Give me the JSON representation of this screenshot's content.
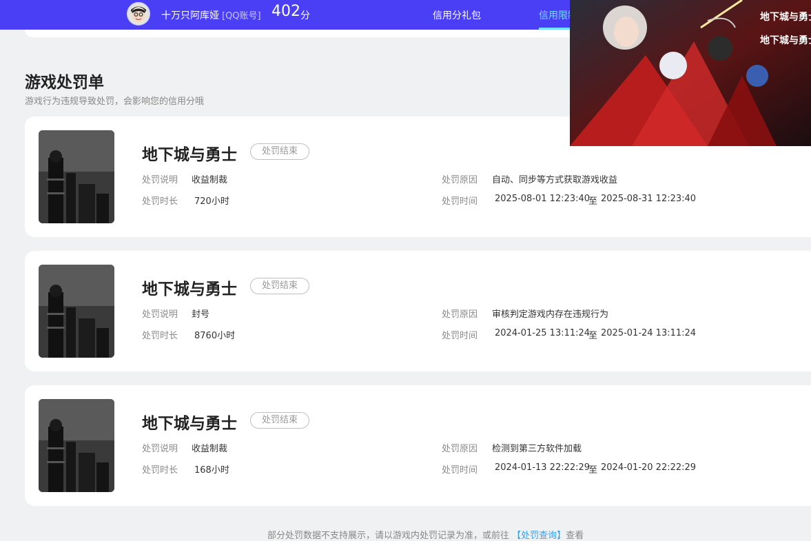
{
  "header": {
    "user_name": "十万只阿库娅",
    "account_type": "[QQ账号]",
    "score": "402",
    "score_unit": "分",
    "nav": [
      {
        "label": "信用分礼包"
      },
      {
        "label": "信用限制"
      }
    ]
  },
  "section": {
    "title": "游戏处罚单",
    "subtitle": "游戏行为违规导致处罚，会影响您的信用分哦"
  },
  "labels": {
    "desc": "处罚说明",
    "duration": "处罚时长",
    "reason": "处罚原因",
    "time": "处罚时间",
    "to": "至"
  },
  "records": [
    {
      "game": "地下城与勇士",
      "status": "处罚结束",
      "desc": "收益制裁",
      "duration": "720小时",
      "reason": "自动、同步等方式获取游戏收益",
      "start": "2025-08-01 12:23:40",
      "end": "2025-08-31 12:23:40"
    },
    {
      "game": "地下城与勇士",
      "status": "处罚结束",
      "desc": "封号",
      "duration": "8760小时",
      "reason": "审核判定游戏内存在违规行为",
      "start": "2024-01-25 13:11:24",
      "end": "2025-01-24 13:11:24"
    },
    {
      "game": "地下城与勇士",
      "status": "处罚结束",
      "desc": "收益制裁",
      "duration": "168小时",
      "reason": "检测到第三方软件加载",
      "start": "2024-01-13 22:22:29",
      "end": "2024-01-20 22:22:29"
    }
  ],
  "footer": {
    "note": "部分处罚数据不支持展示，请以游戏内处罚记录为准，或前往",
    "link": "【处罚查询】",
    "suffix": "查看"
  },
  "ad": {
    "logo_text": "地下城与勇士"
  },
  "colors": {
    "header_bg": "#4a3ff5",
    "active_tab": "#6fe0ff",
    "link": "#3aa0e8"
  }
}
